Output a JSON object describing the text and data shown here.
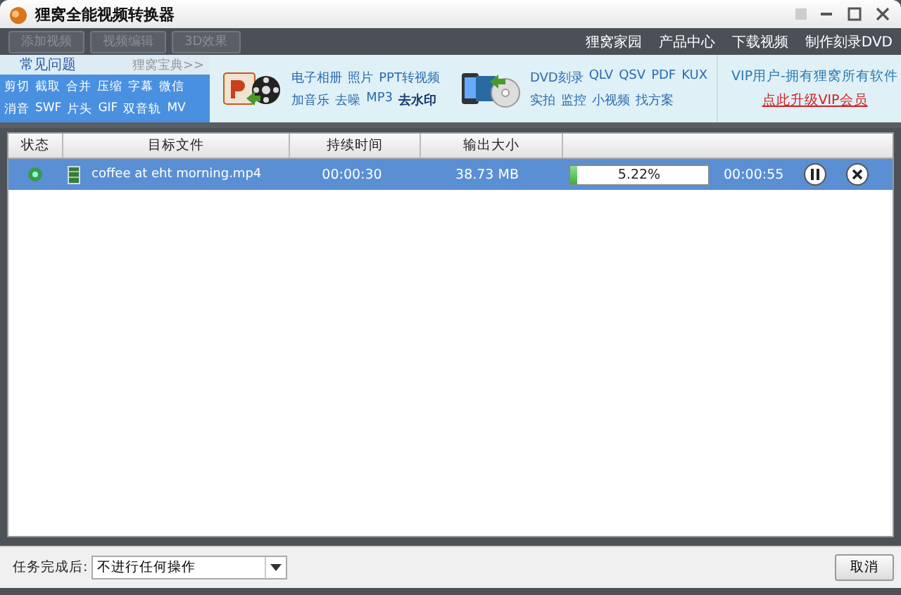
{
  "window": {
    "title": "狸窝全能视频转换器"
  },
  "toolbar": {
    "buttons": [
      {
        "label": "添加视频",
        "disabled": true
      },
      {
        "label": "视频编辑",
        "disabled": true
      },
      {
        "label": "3D效果",
        "disabled": true
      }
    ],
    "links": [
      "狸窝家园",
      "产品中心",
      "下载视频",
      "制作刻录DVD"
    ]
  },
  "promo": {
    "faq": {
      "title": "常见问题",
      "more": "狸窝宝典>>",
      "lines": [
        [
          "剪切",
          "截取",
          "合并",
          "压缩",
          "字幕",
          "微信"
        ],
        [
          "消音",
          "SWF",
          "片头",
          "GIF",
          "双音轨",
          "MV"
        ]
      ]
    },
    "groups": [
      {
        "kind": "ppt",
        "lines": [
          [
            "电子相册",
            "照片",
            "PPT转视频"
          ],
          [
            "加音乐",
            "去噪",
            "MP3",
            "**去水印**"
          ]
        ]
      },
      {
        "kind": "dvd",
        "lines": [
          [
            "DVD刻录",
            "QLV",
            "QSV",
            "PDF",
            "KUX"
          ],
          [
            "实拍",
            "监控",
            "小视频",
            "找方案"
          ]
        ]
      }
    ],
    "vip": {
      "text": "VIP用户-拥有狸窝所有软件",
      "link": "点此升级VIP会员"
    }
  },
  "table": {
    "columns": [
      "状态",
      "目标文件",
      "持续时间",
      "输出大小",
      ""
    ],
    "rows": [
      {
        "selected": true,
        "file": "coffee at eht morning.mp4",
        "duration": "00:00:30",
        "size": "38.73 MB",
        "level": 0.0522,
        "percent": "5.22%",
        "remaining": "00:00:55"
      }
    ]
  },
  "footer": {
    "label": "任务完成后:",
    "select": "不进行任何操作",
    "cancel": "取消"
  }
}
